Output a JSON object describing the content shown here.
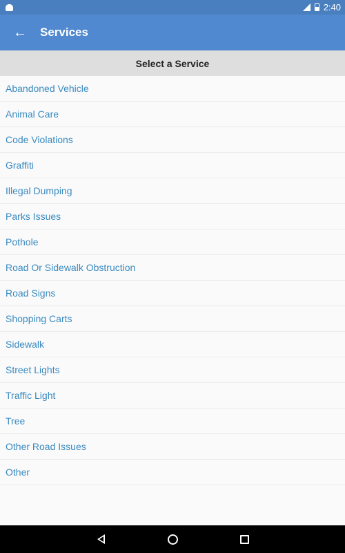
{
  "status_bar": {
    "time": "2:40",
    "icons": [
      "android-icon",
      "signal-icon",
      "battery-icon"
    ]
  },
  "app_bar": {
    "back_icon": "arrow-left-icon",
    "back_glyph": "←",
    "title": "Services"
  },
  "section_header": "Select a Service",
  "services": [
    "Abandoned Vehicle",
    "Animal Care",
    "Code Violations",
    "Graffiti",
    "Illegal Dumping",
    "Parks Issues",
    "Pothole",
    "Road Or Sidewalk Obstruction",
    "Road Signs",
    "Shopping Carts",
    "Sidewalk",
    "Street Lights",
    "Traffic Light",
    "Tree",
    "Other Road Issues",
    "Other"
  ],
  "nav_bar": {
    "buttons": [
      "back",
      "home",
      "recents"
    ]
  },
  "colors": {
    "status_bar": "#4a7fbf",
    "app_bar": "#5089cf",
    "header_bg": "#dedede",
    "link_text": "#3a8ac0"
  }
}
